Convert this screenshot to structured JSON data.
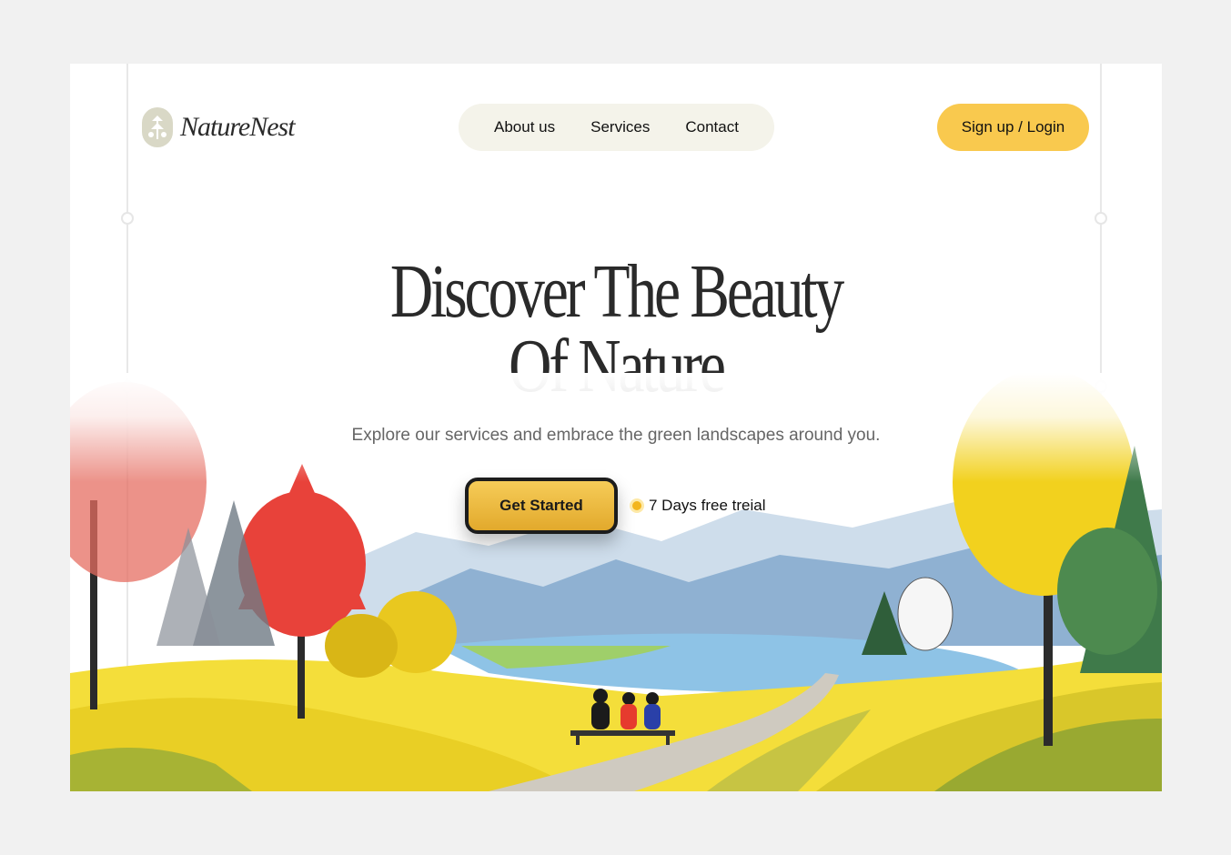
{
  "brand": {
    "name": "NatureNest",
    "logo_icon": "tree-leaf-icon"
  },
  "nav": {
    "items": [
      "About us",
      "Services",
      "Contact"
    ]
  },
  "header": {
    "signup_label": "Sign up / Login"
  },
  "hero": {
    "title_line1": "Discover The Beauty",
    "title_line2": "Of Nature",
    "subtitle": "Explore our services and embrace the green landscapes around you.",
    "cta_label": "Get Started",
    "trial_text": "7 Days free treial"
  },
  "colors": {
    "accent": "#f9c94e",
    "nav_bg": "#f4f3ea",
    "page_bg": "#f1f1f1",
    "text": "#2a2a2a"
  }
}
